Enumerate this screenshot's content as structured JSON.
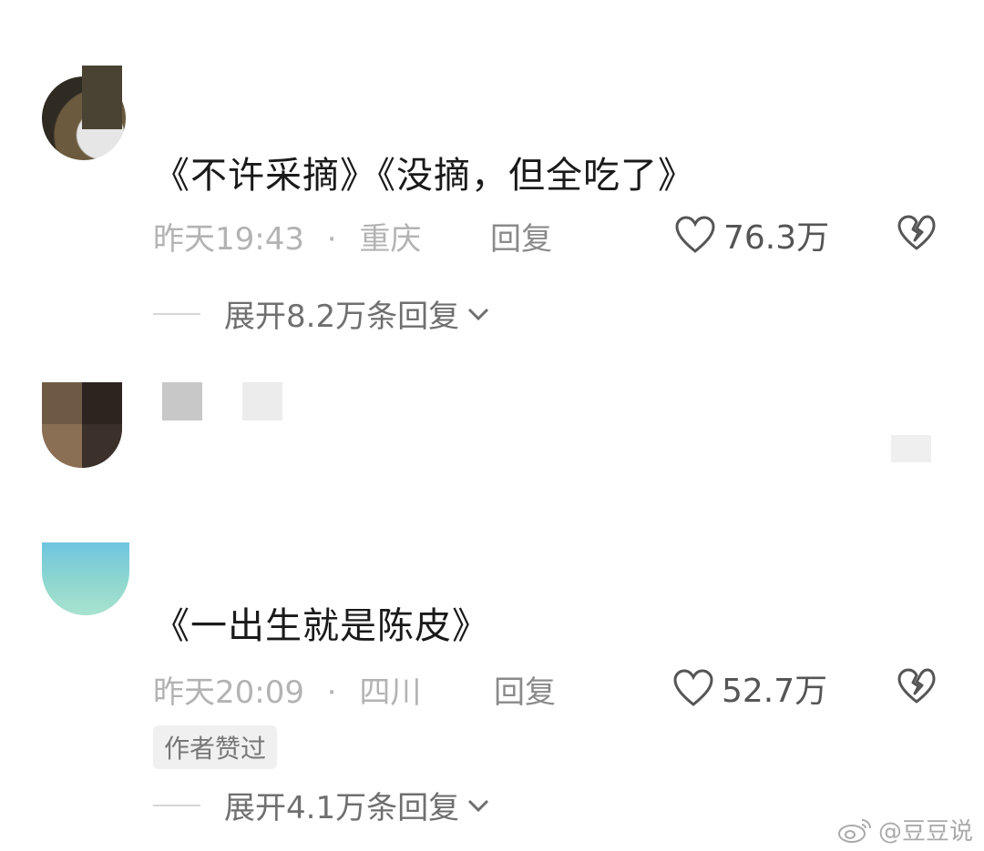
{
  "comments": [
    {
      "text": "《不许采摘》《没摘，但全吃了》",
      "time": "昨天19:43",
      "sep": "·",
      "location": "重庆",
      "reply_label": "回复",
      "likes": "76.3万",
      "expand_label": "展开8.2万条回复"
    },
    {
      "text": "《一出生就是陈皮》",
      "time": "昨天20:09",
      "sep": "·",
      "location": "四川",
      "reply_label": "回复",
      "likes": "52.7万",
      "badge": "作者赞过",
      "expand_label": "展开4.1万条回复"
    }
  ],
  "watermark": {
    "text": "@豆豆说"
  },
  "icons": {
    "like": "heart-outline-icon",
    "dislike": "broken-heart-icon",
    "expand": "chevron-down-icon",
    "watermark": "weibo-logo-icon"
  }
}
